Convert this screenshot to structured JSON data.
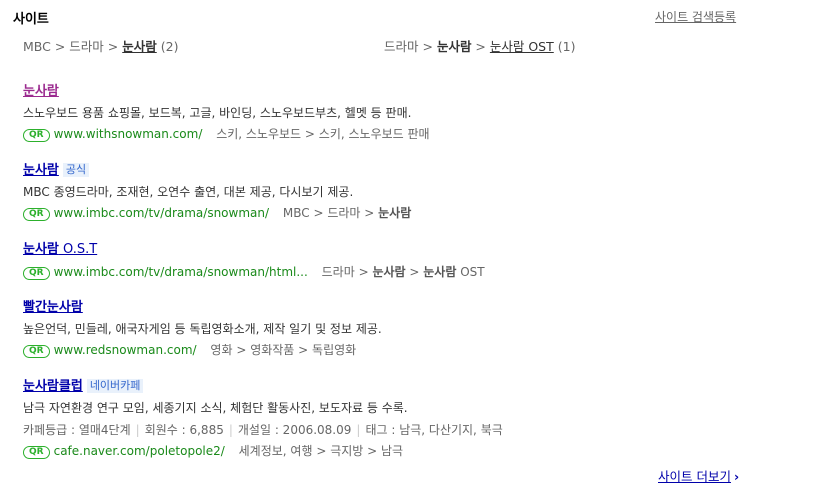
{
  "section": {
    "title": "사이트",
    "register_link": "사이트 검색등록"
  },
  "breadcrumbs": {
    "left": {
      "a": "MBC",
      "b": "드라마",
      "c": "눈사람",
      "count": "(2)"
    },
    "right": {
      "a": "드라마",
      "b": "눈사람",
      "c": "눈사람 OST",
      "count": "(1)"
    }
  },
  "results": [
    {
      "title": "눈사람",
      "desc": "스노우보드 용품 쇼핑몰, 보드복, 고글, 바인딩, 스노우보드부츠, 헬멧 등 판매.",
      "qr": "QR",
      "url": "www.withsnowman.com/",
      "cat": [
        "스키, 스노우보드",
        "스키, 스노우보드 판매"
      ]
    },
    {
      "title": "눈사람",
      "badge": "공식",
      "desc": "MBC 종영드라마, 조재현, 오연수 출연, 대본 제공, 다시보기 제공.",
      "qr": "QR",
      "url": "www.imbc.com/tv/drama/snowman/",
      "cat": [
        "MBC",
        "드라마",
        "눈사람"
      ]
    },
    {
      "title_bold": "눈사람",
      "title_suffix": " O.S.T",
      "qr": "QR",
      "url": "www.imbc.com/tv/drama/snowman/html...",
      "cat": [
        "드라마",
        "눈사람",
        "눈사람",
        "OST"
      ]
    },
    {
      "title": "빨간눈사람",
      "desc": "높은언덕, 민들레, 애국자게임 등 독립영화소개, 제작 일기 및 정보 제공.",
      "qr": "QR",
      "url": "www.redsnowman.com/",
      "cat": [
        "영화",
        "영화작품",
        "독립영화"
      ]
    },
    {
      "title": "눈사람클럽",
      "badge": "네이버카페",
      "desc": "남극 자연환경 연구 모임, 세종기지 소식, 체험단 활동사진, 보도자료 등 수록.",
      "meta": [
        "카페등급 : 열매4단계",
        "회원수 : 6,885",
        "개설일 : 2006.08.09",
        "태그 : 남극, 다산기지, 북극"
      ],
      "qr": "QR",
      "url": "cafe.naver.com/poletopole2/",
      "cat": [
        "세계정보, 여행",
        "극지방",
        "남극"
      ]
    }
  ],
  "more": {
    "label": "사이트 더보기",
    "arrow": "›"
  },
  "colors": {
    "link": "#0000aa",
    "visited": "#9b2a8f",
    "url": "#1a8a1a",
    "qr": "#2cb02c"
  }
}
